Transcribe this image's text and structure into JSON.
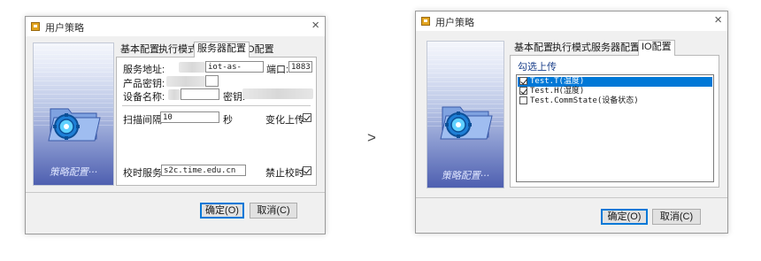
{
  "left_dialog": {
    "title": "用户策略",
    "close": "×",
    "banner_text": "策略配置···",
    "tabs": [
      "基本配置",
      "执行模式",
      "服务器配置",
      "IO配置"
    ],
    "server": {
      "address_label": "服务地址:",
      "address_value": "iot-as-",
      "port_label": "端口:",
      "port_value": "1883",
      "product_secret_label": "产品密钥:",
      "device_name_label": "设备名称:",
      "device_secret_label": "密钥:"
    },
    "scan_interval_label": "扫描间隔:",
    "scan_interval_value": "10",
    "scan_unit": "秒",
    "change_upload_label": "变化上传",
    "change_upload_checked": true,
    "time_server_label": "校时服务:",
    "time_server_value": "s2c.time.edu.cn",
    "disable_time_sync_label": "禁止校时",
    "disable_time_sync_checked": true,
    "ok_button": "确定(O)",
    "cancel_button": "取消(C)"
  },
  "arrow": ">",
  "right_dialog": {
    "title": "用户策略",
    "close": "×",
    "banner_text": "策略配置···",
    "tabs": [
      "基本配置",
      "执行模式",
      "服务器配置",
      "IO配置"
    ],
    "upload_group_label": "勾选上传",
    "upload_items": [
      {
        "label": "Test.T(温度)",
        "checked": true,
        "selected": true
      },
      {
        "label": "Test.H(湿度)",
        "checked": true,
        "selected": false
      },
      {
        "label": "Test.CommState(设备状态)",
        "checked": false,
        "selected": false
      }
    ],
    "ok_button": "确定(O)",
    "cancel_button": "取消(C)"
  }
}
